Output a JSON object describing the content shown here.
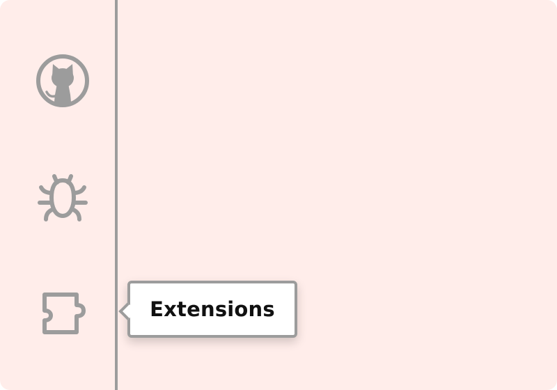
{
  "activity_bar": {
    "items": [
      {
        "id": "github",
        "icon": "github-icon"
      },
      {
        "id": "debug",
        "icon": "bug-icon"
      },
      {
        "id": "extensions",
        "icon": "extensions-icon"
      }
    ]
  },
  "tooltip": {
    "label": "Extensions"
  },
  "colors": {
    "background": "#ffedea",
    "icon": "#9c9c9c",
    "tooltip_bg": "#ffffff",
    "tooltip_text": "#111111"
  }
}
